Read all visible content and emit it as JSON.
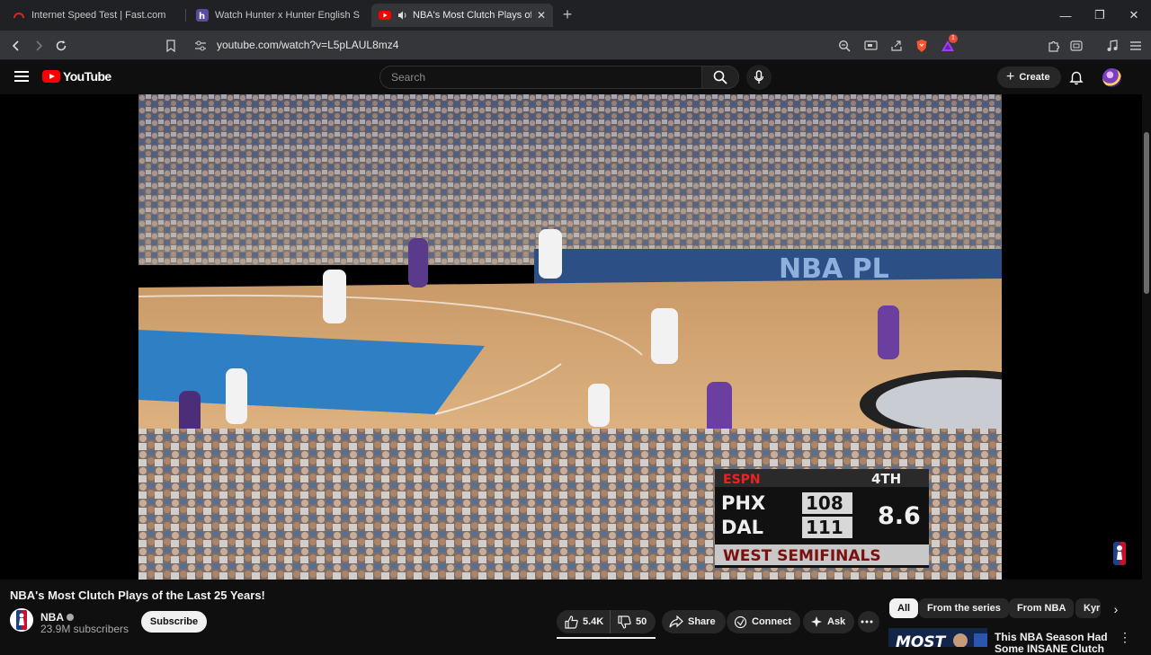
{
  "browser": {
    "tabs": [
      {
        "title": "Internet Speed Test | Fast.com",
        "favicon": "fast-icon",
        "active": false
      },
      {
        "title": "Watch Hunter x Hunter English Sub/Du",
        "favicon": "h-icon",
        "active": false
      },
      {
        "title": "NBA's Most Clutch Plays of the Last",
        "favicon": "youtube-icon",
        "active": true,
        "audio": true
      }
    ],
    "url": "youtube.com/watch?v=L5pLAUL8mz4",
    "extension_badge": "1"
  },
  "youtube": {
    "logo_text": "YouTube",
    "search_placeholder": "Search",
    "create_label": "Create"
  },
  "video": {
    "scoreboard": {
      "network": "ESPN",
      "quarter": "4TH",
      "team1": "PHX",
      "score1": "108",
      "team2": "DAL",
      "score2": "111",
      "clock": "8.6",
      "series": "WEST SEMIFINALS"
    },
    "watermark": "NBA",
    "court_text": "NBA PL"
  },
  "details": {
    "title": "NBA's Most Clutch Plays of the Last 25 Years!",
    "channel": "NBA",
    "subscribers": "23.9M subscribers",
    "subscribe_label": "Subscribe",
    "likes": "5.4K",
    "dislikes": "50",
    "share_label": "Share",
    "connect_label": "Connect",
    "ask_label": "Ask"
  },
  "chips": [
    "All",
    "From the series",
    "From NBA",
    "Kyr"
  ],
  "recommended": {
    "title_line1": "This NBA Season Had",
    "title_line2": "Some INSANE Clutch",
    "thumb_text": "MOST"
  },
  "colors": {
    "background": "#0f0f0f",
    "youtube_red": "#ff0000",
    "court_blue": "#2e7fc4",
    "court_wood": "#d9a872"
  }
}
